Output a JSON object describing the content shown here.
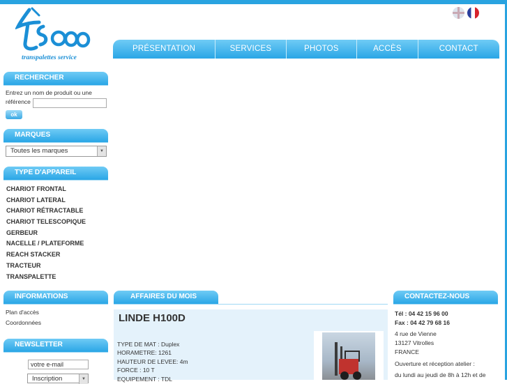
{
  "brand": {
    "logo_sub": "transpalettes service"
  },
  "languages": [
    "English",
    "Français"
  ],
  "nav": [
    "PRÉSENTATION",
    "SERVICES",
    "PHOTOS",
    "ACCÈS",
    "CONTACT"
  ],
  "search": {
    "title": "RECHERCHER",
    "label_line1": "Entrez un nom de produit ou une",
    "label_line2": "référence",
    "input_value": "",
    "ok_label": "ok"
  },
  "brands": {
    "title": "MARQUES",
    "selected": "Toutes les marques"
  },
  "device_types": {
    "title": "TYPE D'APPAREIL",
    "items": [
      "CHARIOT FRONTAL",
      "CHARIOT LATERAL",
      "CHARIOT RÉTRACTABLE",
      "CHARIOT TELESCOPIQUE",
      "GERBEUR",
      "NACELLE / PLATEFORME",
      "REACH STACKER",
      "TRACTEUR",
      "TRANSPALETTE"
    ]
  },
  "informations": {
    "title": "INFORMATIONS",
    "links": [
      "Plan d'accès",
      "Coordonnées"
    ]
  },
  "newsletter": {
    "title": "NEWSLETTER",
    "email_value": "votre e-mail",
    "action_selected": "Inscription"
  },
  "deals": {
    "title": "AFFAIRES DU MOIS",
    "product_title": "LINDE H100D",
    "specs": [
      "TYPE DE MAT : Duplex",
      "HORAMETRE: 1261",
      "HAUTEUR DE LEVEE: 4m",
      "FORCE : 10 T",
      "EQUIPEMENT : TDL"
    ]
  },
  "contact": {
    "title": "CONTACTEZ-NOUS",
    "tel": "Tél : 04 42 15 96 00",
    "fax": "Fax : 04 42 79 68 16",
    "address": [
      "4 rue de Vienne",
      "13127 Vitrolles",
      "FRANCE"
    ],
    "hours": [
      "Ouverture et réception atelier :",
      "du lundi au jeudi de 8h à 12h et de"
    ]
  },
  "colors": {
    "accent": "#29a3e0",
    "header_gradient_top": "#6fcbf5",
    "panel_bg": "#e4f2fb"
  }
}
